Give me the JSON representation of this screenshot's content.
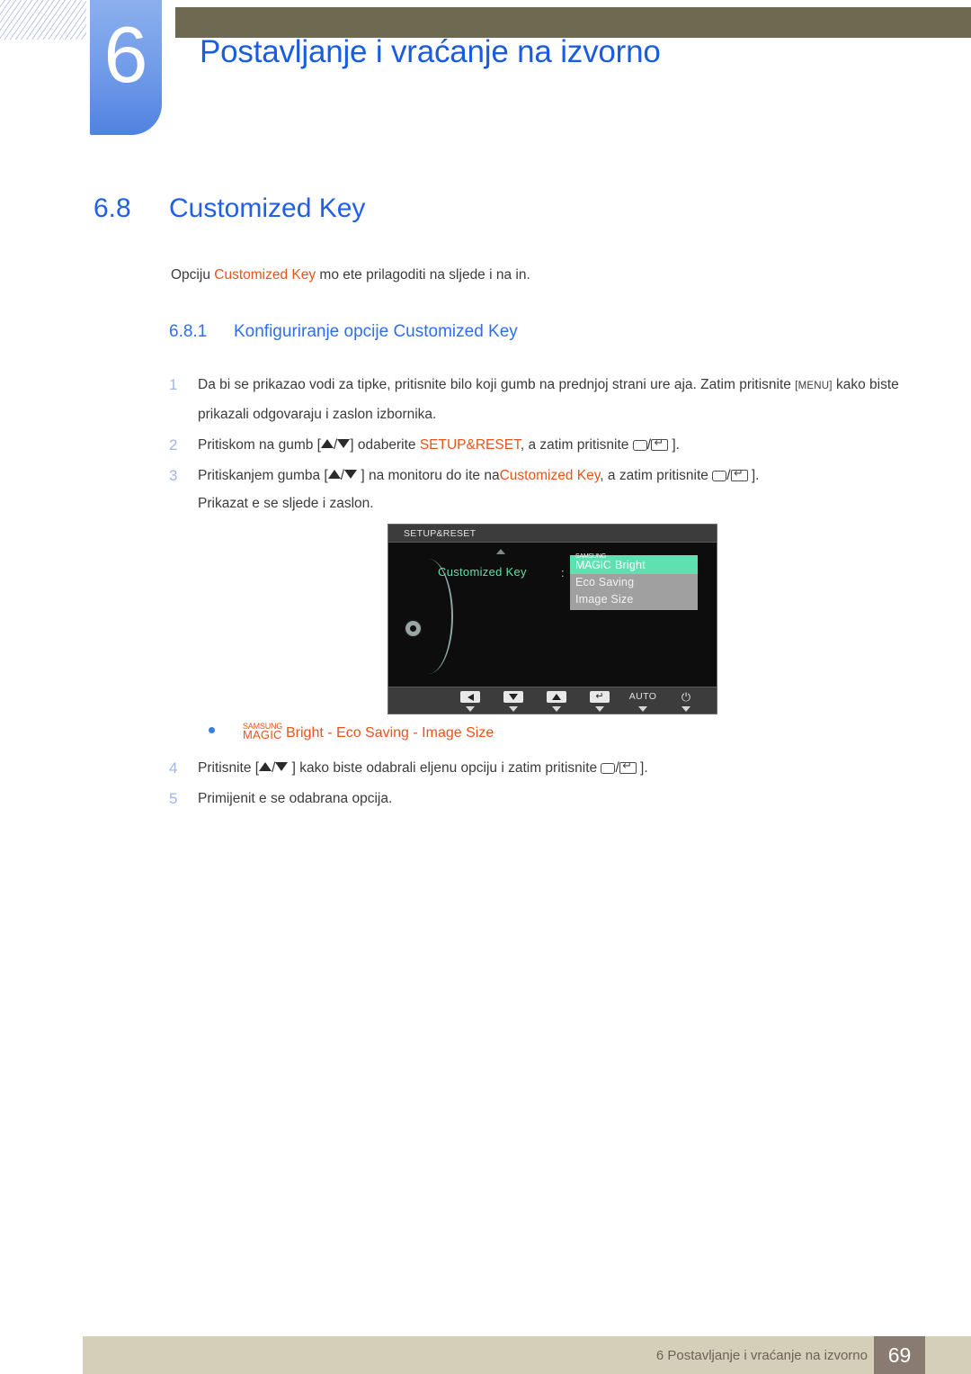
{
  "header": {
    "chapter_number": "6",
    "chapter_title": "Postavljanje i vraćanje na izvorno",
    "bar_color": "#6e6a52",
    "chapter_block_color": "#6f9ae8",
    "title_color": "#1a5ce0"
  },
  "section": {
    "number": "6.8",
    "title": "Customized Key",
    "heading_color": "#2060e8"
  },
  "intro": {
    "before": "Opciju ",
    "highlight": "Customized Key",
    "after": " mo ete prilagoditi na sljede i na in.",
    "highlight_color": "#e8541b"
  },
  "subsection": {
    "number": "6.8.1",
    "title": "Konfiguriranje opcije Customized Key"
  },
  "steps": [
    {
      "num": "1",
      "parts": [
        {
          "type": "text",
          "value": "Da bi se prikazao vodi  za tipke, pritisnite bilo koji gumb na prednjoj strani ure aja. Zatim pritisnite "
        },
        {
          "type": "kbd",
          "value": "[MENU]"
        },
        {
          "type": "text",
          "value": " kako biste prikazali odgovaraju i zaslon izbornika."
        }
      ]
    },
    {
      "num": "2",
      "parts": [
        {
          "type": "text",
          "value": "Pritiskom na gumb ["
        },
        {
          "type": "tri-up",
          "value": "▲"
        },
        {
          "type": "text",
          "value": "/"
        },
        {
          "type": "tri-down",
          "value": "▼"
        },
        {
          "type": "text",
          "value": "] odaberite "
        },
        {
          "type": "orange",
          "value": "SETUP&RESET"
        },
        {
          "type": "text",
          "value": ", a zatim pritisnite "
        },
        {
          "type": "glyph-rect",
          "value": "menu-button-icon"
        },
        {
          "type": "text",
          "value": "/"
        },
        {
          "type": "glyph-enter",
          "value": "enter-button-icon"
        },
        {
          "type": "text",
          "value": " ]."
        }
      ]
    },
    {
      "num": "3",
      "parts": [
        {
          "type": "text",
          "value": "Pritiskanjem gumba ["
        },
        {
          "type": "tri-up",
          "value": "▲"
        },
        {
          "type": "text",
          "value": "/"
        },
        {
          "type": "tri-down",
          "value": "▼"
        },
        {
          "type": "text",
          "value": " ] na monitoru do ite na"
        },
        {
          "type": "orange",
          "value": "Customized Key"
        },
        {
          "type": "text",
          "value": ", a zatim pritisnite "
        },
        {
          "type": "glyph-rect",
          "value": "menu-button-icon"
        },
        {
          "type": "text",
          "value": "/"
        },
        {
          "type": "glyph-enter",
          "value": "enter-button-icon"
        },
        {
          "type": "text",
          "value": " ]."
        }
      ],
      "continuation": "Prikazat  e se sljede i zaslon."
    }
  ],
  "steps_tail": [
    {
      "num": "4",
      "parts": [
        {
          "type": "text",
          "value": "Pritisnite ["
        },
        {
          "type": "tri-up",
          "value": "▲"
        },
        {
          "type": "text",
          "value": "/"
        },
        {
          "type": "tri-down",
          "value": "▼"
        },
        {
          "type": "text",
          "value": " ] kako biste odabrali  eljenu opciju i zatim pritisnite "
        },
        {
          "type": "glyph-rect",
          "value": "menu-button-icon"
        },
        {
          "type": "text",
          "value": "/"
        },
        {
          "type": "glyph-enter",
          "value": "enter-button-icon"
        },
        {
          "type": "text",
          "value": " ]."
        }
      ]
    },
    {
      "num": "5",
      "parts": [
        {
          "type": "text",
          "value": "Primijenit  e se odabrana opcija."
        }
      ]
    }
  ],
  "osd": {
    "title": "SETUP&RESET",
    "label": "Customized Key",
    "colon": ":",
    "label_color": "#5fe0a8",
    "menu_items": [
      {
        "samsung": "SAMSUNG",
        "magic": "MAGIC",
        "label": "Bright",
        "selected": true
      },
      {
        "label": "Eco Saving",
        "selected": false
      },
      {
        "label": "Image Size",
        "selected": false
      }
    ],
    "selected_bg": "#5fe0b0",
    "menu_bg": "#a0a0a0",
    "footer_buttons": [
      {
        "kind": "left",
        "label": ""
      },
      {
        "kind": "down",
        "label": ""
      },
      {
        "kind": "up",
        "label": ""
      },
      {
        "kind": "return",
        "label": ""
      },
      {
        "kind": "text",
        "label": "AUTO"
      },
      {
        "kind": "power",
        "label": "⏻"
      }
    ]
  },
  "bullet": {
    "samsung": "SAMSUNG",
    "magic": "MAGIC",
    "text": "Bright  -  Eco Saving  -  Image Size",
    "color": "#e8541b"
  },
  "footer": {
    "text": "6 Postavljanje i vraćanje na izvorno",
    "page": "69",
    "band_color": "#d5cfba",
    "page_box_color": "#897b72"
  }
}
